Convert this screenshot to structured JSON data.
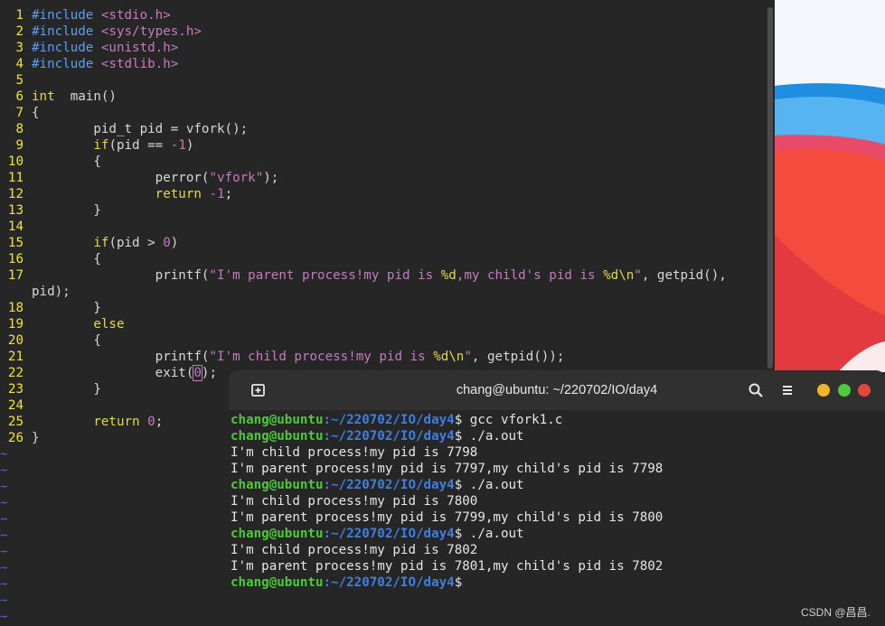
{
  "editor": {
    "lines": [
      {
        "n": "1",
        "segs": [
          [
            "pp",
            "#include "
          ],
          [
            "str",
            "<stdio.h>"
          ]
        ]
      },
      {
        "n": "2",
        "segs": [
          [
            "pp",
            "#include "
          ],
          [
            "str",
            "<sys/types.h>"
          ]
        ]
      },
      {
        "n": "3",
        "segs": [
          [
            "pp",
            "#include "
          ],
          [
            "str",
            "<unistd.h>"
          ]
        ]
      },
      {
        "n": "4",
        "segs": [
          [
            "pp",
            "#include "
          ],
          [
            "str",
            "<stdlib.h>"
          ]
        ]
      },
      {
        "n": "5",
        "segs": []
      },
      {
        "n": "6",
        "segs": [
          [
            "kw",
            "int"
          ],
          [
            "",
            "  main()"
          ]
        ]
      },
      {
        "n": "7",
        "segs": [
          [
            "",
            "{"
          ]
        ]
      },
      {
        "n": "8",
        "segs": [
          [
            "",
            "        pid_t pid = vfork();"
          ]
        ]
      },
      {
        "n": "9",
        "segs": [
          [
            "",
            "        "
          ],
          [
            "kw",
            "if"
          ],
          [
            "",
            "(pid == "
          ],
          [
            "num",
            "-1"
          ],
          [
            "",
            ")"
          ]
        ]
      },
      {
        "n": "10",
        "segs": [
          [
            "",
            "        {"
          ]
        ]
      },
      {
        "n": "11",
        "segs": [
          [
            "",
            "                perror("
          ],
          [
            "str",
            "\"vfork\""
          ],
          [
            "",
            ");"
          ]
        ]
      },
      {
        "n": "12",
        "segs": [
          [
            "",
            "                "
          ],
          [
            "kw",
            "return"
          ],
          [
            "",
            " "
          ],
          [
            "num",
            "-1"
          ],
          [
            "",
            ";"
          ]
        ]
      },
      {
        "n": "13",
        "segs": [
          [
            "",
            "        }"
          ]
        ]
      },
      {
        "n": "14",
        "segs": []
      },
      {
        "n": "15",
        "segs": [
          [
            "",
            "        "
          ],
          [
            "kw",
            "if"
          ],
          [
            "",
            "(pid > "
          ],
          [
            "num",
            "0"
          ],
          [
            "",
            ")"
          ]
        ]
      },
      {
        "n": "16",
        "segs": [
          [
            "",
            "        {"
          ]
        ]
      },
      {
        "n": "17",
        "segs": [
          [
            "",
            "                printf("
          ],
          [
            "str",
            "\"I'm parent process!my pid is "
          ],
          [
            "kw",
            "%d"
          ],
          [
            "str",
            ",my child's pid is "
          ],
          [
            "kw",
            "%d\\n"
          ],
          [
            "str",
            "\""
          ],
          [
            "",
            ", getpid(),"
          ]
        ]
      },
      {
        "n": "",
        "segs": [
          [
            "",
            "pid);"
          ]
        ]
      },
      {
        "n": "18",
        "segs": [
          [
            "",
            "        }"
          ]
        ]
      },
      {
        "n": "19",
        "segs": [
          [
            "",
            "        "
          ],
          [
            "kw",
            "else"
          ]
        ]
      },
      {
        "n": "20",
        "segs": [
          [
            "",
            "        {"
          ]
        ]
      },
      {
        "n": "21",
        "segs": [
          [
            "",
            "                printf("
          ],
          [
            "str",
            "\"I'm child process!my pid is "
          ],
          [
            "kw",
            "%d\\n"
          ],
          [
            "str",
            "\""
          ],
          [
            "",
            ", getpid());"
          ]
        ]
      },
      {
        "n": "22",
        "segs": [
          [
            "",
            "                exit("
          ],
          [
            "cursor",
            "0"
          ],
          [
            "",
            ");"
          ]
        ]
      },
      {
        "n": "23",
        "segs": [
          [
            "",
            "        }"
          ]
        ]
      },
      {
        "n": "24",
        "segs": []
      },
      {
        "n": "25",
        "segs": [
          [
            "",
            "        "
          ],
          [
            "kw",
            "return"
          ],
          [
            "",
            " "
          ],
          [
            "num",
            "0"
          ],
          [
            "",
            ";"
          ]
        ]
      },
      {
        "n": "26",
        "segs": [
          [
            "",
            "}"
          ]
        ]
      }
    ],
    "tilde_count": 11,
    "tilde_char": "~"
  },
  "terminal": {
    "title": "chang@ubuntu: ~/220702/IO/day4",
    "new_tab_icon": "new-tab-icon",
    "search_icon": "search-icon",
    "menu_icon": "hamburger-menu-icon",
    "window_controls": {
      "minimize": "#f4b42a",
      "maximize": "#4ec93a",
      "close": "#e6463c"
    },
    "prompt_user": "chang@ubuntu",
    "prompt_path": ":~/220702/IO/day4",
    "prompt_symbol": "$",
    "lines": [
      {
        "type": "prompt",
        "cmd": " gcc vfork1.c"
      },
      {
        "type": "prompt",
        "cmd": " ./a.out"
      },
      {
        "type": "out",
        "text": "I'm child process!my pid is 7798"
      },
      {
        "type": "out",
        "text": "I'm parent process!my pid is 7797,my child's pid is 7798"
      },
      {
        "type": "prompt",
        "cmd": " ./a.out"
      },
      {
        "type": "out",
        "text": "I'm child process!my pid is 7800"
      },
      {
        "type": "out",
        "text": "I'm parent process!my pid is 7799,my child's pid is 7800"
      },
      {
        "type": "prompt",
        "cmd": " ./a.out"
      },
      {
        "type": "out",
        "text": "I'm child process!my pid is 7802"
      },
      {
        "type": "out",
        "text": "I'm parent process!my pid is 7801,my child's pid is 7802"
      },
      {
        "type": "prompt",
        "cmd": ""
      }
    ]
  },
  "watermark": "CSDN @昌昌."
}
